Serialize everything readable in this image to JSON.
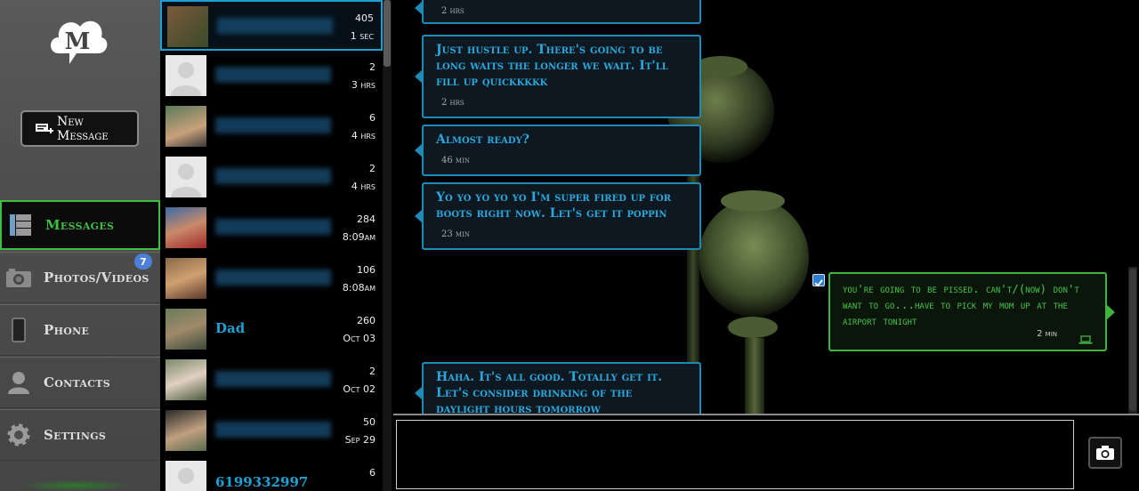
{
  "app": {
    "logo_letter": "M"
  },
  "nav": {
    "new_message_label": "New Message",
    "items": [
      {
        "label": "Messages",
        "icon": "messages-icon"
      },
      {
        "label": "Photos/Videos",
        "icon": "camera-icon",
        "badge": "7"
      },
      {
        "label": "Phone",
        "icon": "phone-icon"
      },
      {
        "label": "Contacts",
        "icon": "contacts-icon"
      },
      {
        "label": "Settings",
        "icon": "gear-icon"
      }
    ]
  },
  "conversations": [
    {
      "name": "",
      "count": "405",
      "time": "1 sec",
      "selected": true
    },
    {
      "name": "",
      "count": "2",
      "time": "3 hrs"
    },
    {
      "name": "",
      "count": "6",
      "time": "4 hrs"
    },
    {
      "name": "",
      "count": "2",
      "time": "4 hrs"
    },
    {
      "name": "",
      "count": "284",
      "time": "8:09am"
    },
    {
      "name": "",
      "count": "106",
      "time": "8:08am"
    },
    {
      "name": "Dad",
      "count": "260",
      "time": "Oct 03"
    },
    {
      "name": "",
      "count": "2",
      "time": "Oct 02"
    },
    {
      "name": "",
      "count": "50",
      "time": "Sep 29"
    },
    {
      "name": "6199332997",
      "count": "6",
      "time": ""
    }
  ],
  "messages": [
    {
      "direction": "in",
      "text": "",
      "time": "2 hrs"
    },
    {
      "direction": "in",
      "text": "Just hustle up. There's going to be long waits the longer we wait. It'll fill up quickkkkk",
      "time": "2 hrs"
    },
    {
      "direction": "in",
      "text": "Almost ready?",
      "time": "46 min"
    },
    {
      "direction": "in",
      "text": "Yo yo yo yo yo I'm super fired up for boots right now. Let's get it poppin",
      "time": "23 min"
    },
    {
      "direction": "out",
      "text": "you're going to be pissed. can't/(now) don't want to go...have to pick my mom up at the airport tonight",
      "time": "2 min",
      "device_icon": "laptop-icon"
    },
    {
      "direction": "in",
      "text": "Haha. It's all good. Totally get it. Let's consider drinking of the daylight hours tomorrow",
      "time": ""
    }
  ],
  "compose": {
    "placeholder": "",
    "camera_icon": "camera-icon"
  },
  "colors": {
    "accent_blue": "#1da1d4",
    "accent_green": "#3fbf3f",
    "badge_blue": "#4d7fd8"
  }
}
